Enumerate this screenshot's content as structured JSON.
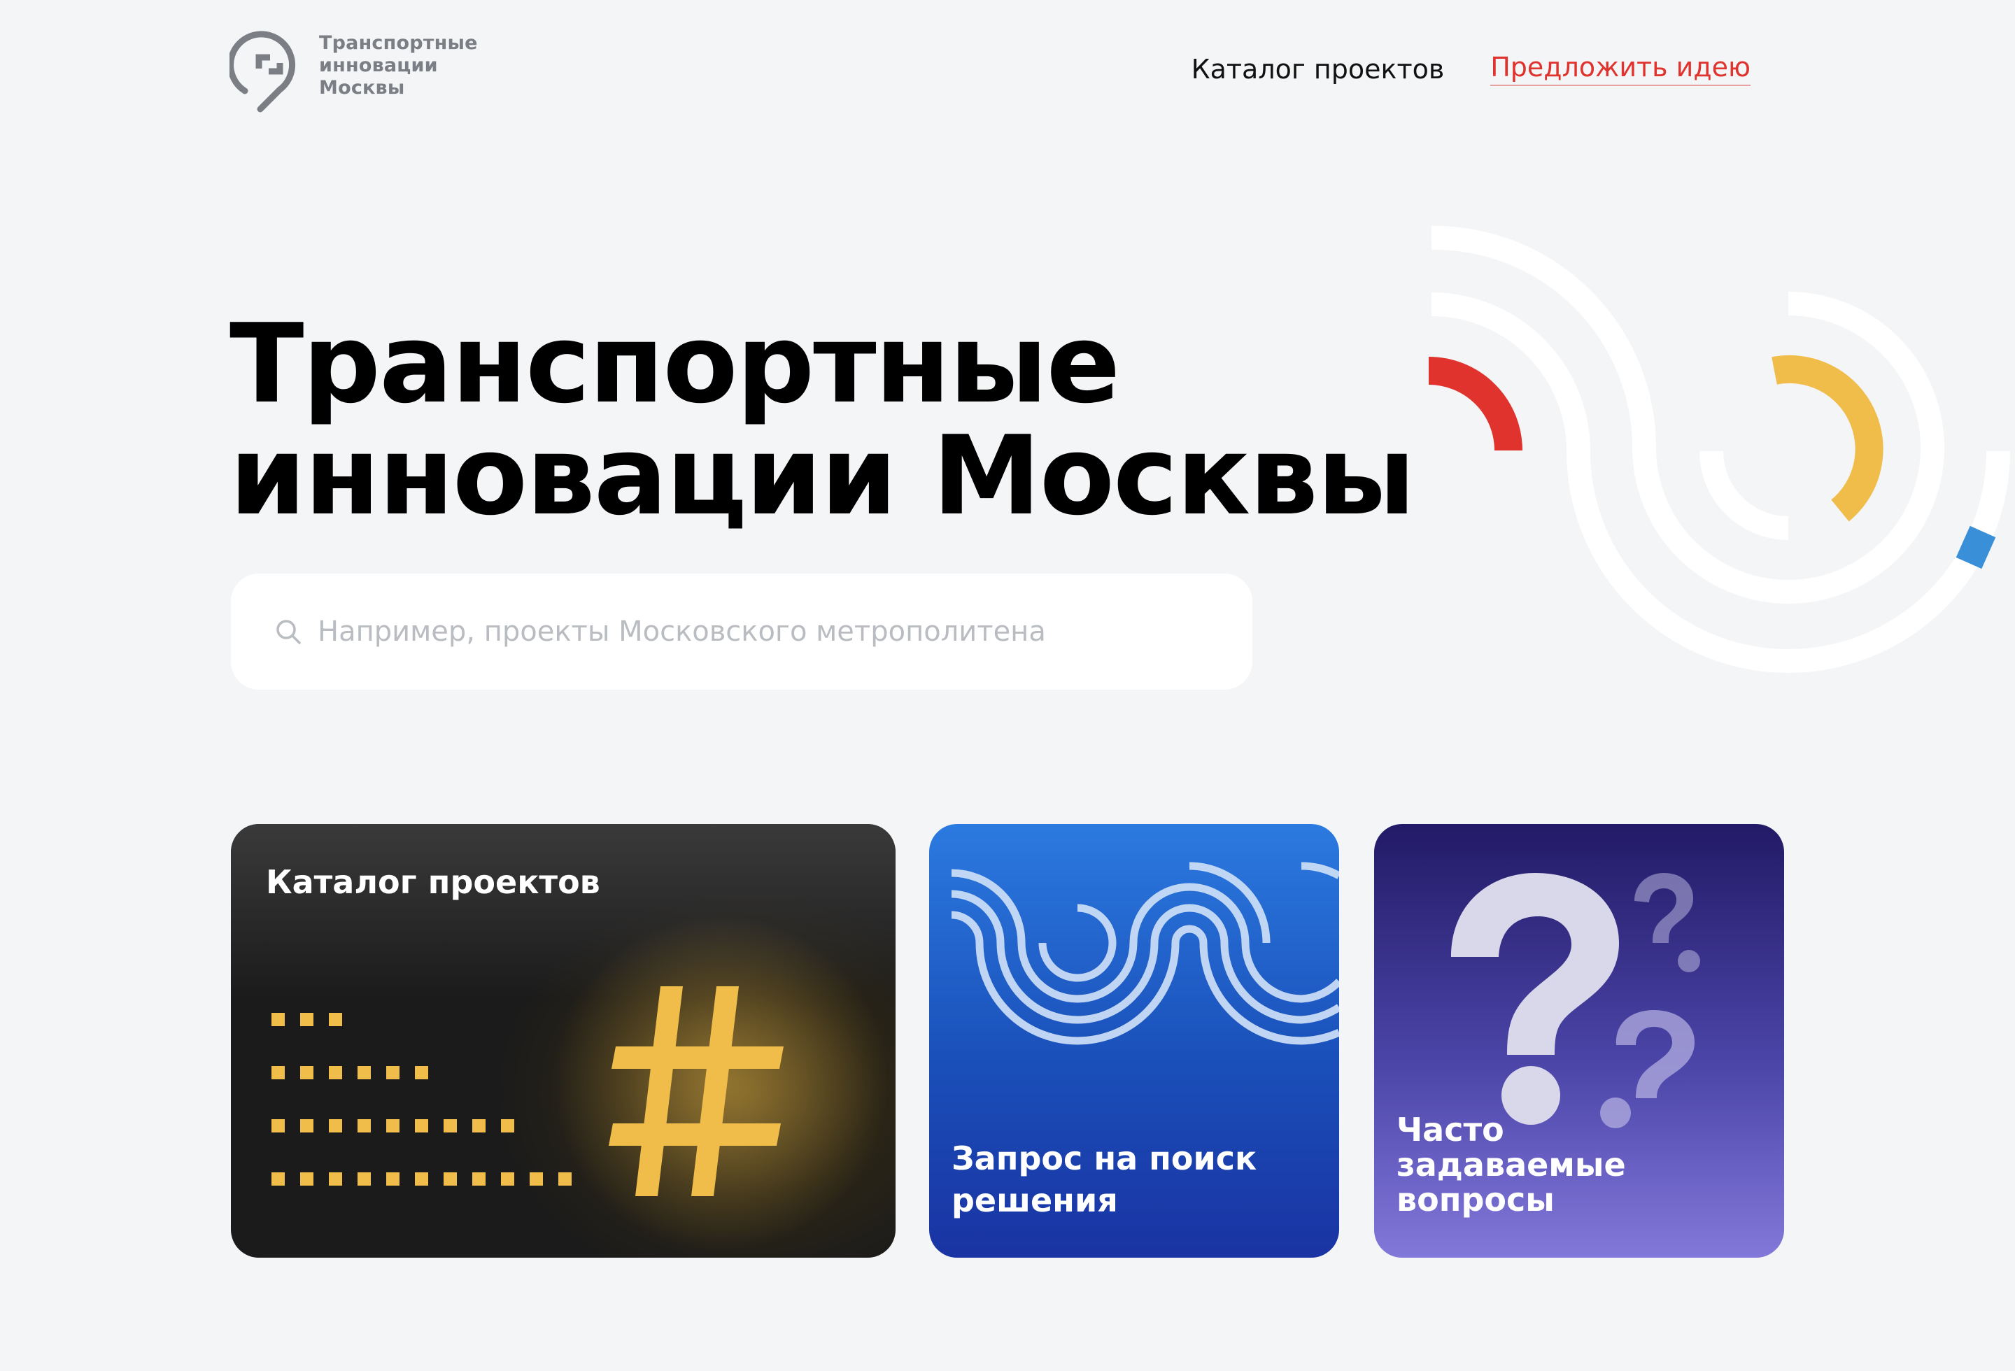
{
  "header": {
    "logo": {
      "line1": "Транспортные",
      "line2": "инновации",
      "line3": "Москвы"
    },
    "nav": {
      "catalog": "Каталог проектов",
      "suggest": "Предложить идею"
    }
  },
  "hero": {
    "title_line1": "Транспортные",
    "title_line2": "инновации Москвы",
    "search_placeholder": "Например, проекты Московского метрополитена"
  },
  "cards": {
    "catalog": "Каталог проектов",
    "request": "Запрос на поиск решения",
    "faq": "Часто задаваемые вопросы"
  },
  "colors": {
    "background": "#f4f5f7",
    "accent_red": "#e0332e",
    "accent_yellow": "#f0bd4a",
    "accent_blue": "#3a8fd9"
  }
}
